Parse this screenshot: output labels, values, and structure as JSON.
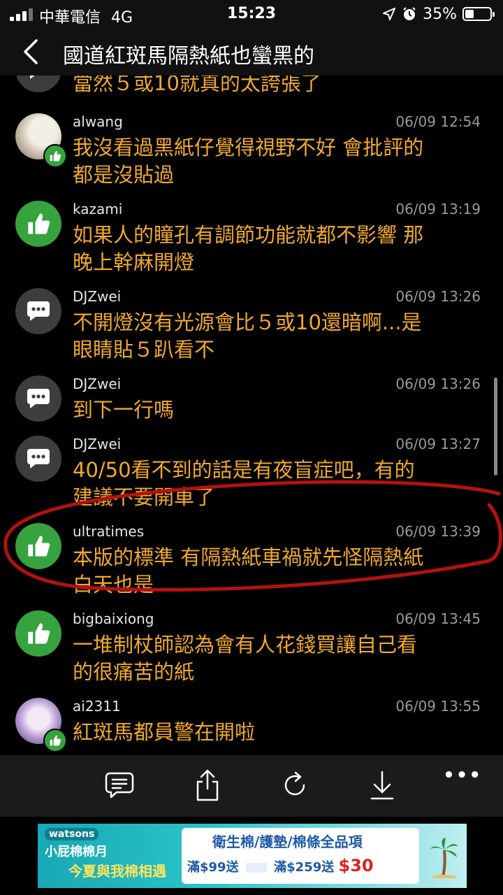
{
  "status": {
    "carrier": "中華電信",
    "network": "4G",
    "time": "15:23",
    "battery": "35%"
  },
  "header": {
    "title": "國道紅斑馬隔熱紙也蠻黑的"
  },
  "comments": [
    {
      "user": "",
      "time": "",
      "text": "當然５或10就真的太誇張了",
      "avatar": "speech-bubble"
    },
    {
      "user": "alwang",
      "time": "06/09 12:54",
      "text": "我沒看過黑紙仔覺得視野不好 會批評的\n都是沒貼過",
      "avatar": "photo-like"
    },
    {
      "user": "kazami",
      "time": "06/09 13:19",
      "text": "如果人的瞳孔有調節功能就都不影響 那\n晚上幹麻開燈",
      "avatar": "thumbs-up"
    },
    {
      "user": "DJZwei",
      "time": "06/09 13:26",
      "text": "不開燈沒有光源會比５或10還暗啊...是\n眼睛貼５趴看不",
      "avatar": "speech-bubble"
    },
    {
      "user": "DJZwei",
      "time": "06/09 13:26",
      "text": "到下一行嗎",
      "avatar": "speech-bubble"
    },
    {
      "user": "DJZwei",
      "time": "06/09 13:27",
      "text": "40/50看不到的話是有夜盲症吧，有的\n建議不要開車了",
      "avatar": "speech-bubble"
    },
    {
      "user": "ultratimes",
      "time": "06/09 13:39",
      "text": "本版的標準 有隔熱紙車禍就先怪隔熱紙\n白天也是",
      "avatar": "thumbs-up"
    },
    {
      "user": "bigbaixiong",
      "time": "06/09 13:45",
      "text": "一堆制杖師認為會有人花錢買讓自己看\n的很痛苦的紙",
      "avatar": "thumbs-up"
    },
    {
      "user": "ai2311",
      "time": "06/09 13:55",
      "text": "紅斑馬都員警在開啦",
      "avatar": "photo-like"
    }
  ],
  "toolbar": {
    "more": "•••"
  },
  "ad": {
    "brand": "watsons",
    "tagline1": "小屁棉棉月",
    "tagline2": "今夏與我棉相遇",
    "headline": "衛生棉/護墊/棉條全品項",
    "offer_a": "滿$99送",
    "offer_b": "滿$259送",
    "offer_price": "$30",
    "colors": {
      "primary": "#1d5aa8",
      "accent": "#e02020"
    }
  },
  "colors": {
    "comment_text": "#f0a92d",
    "annotation": "#b3120f",
    "thumb_green": "#36a33f"
  }
}
